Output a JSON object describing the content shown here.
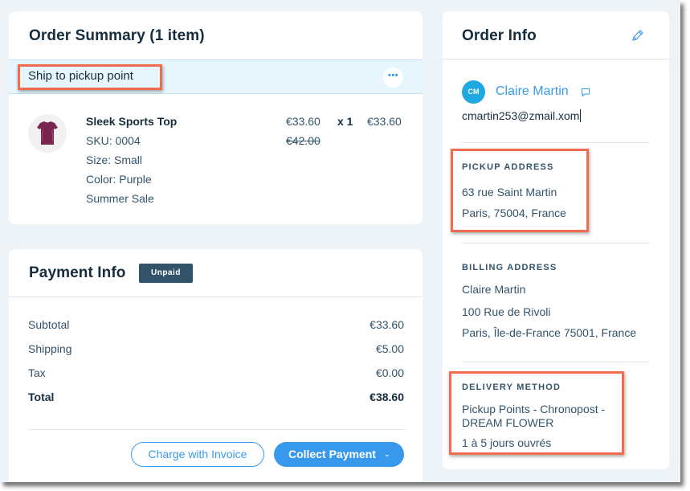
{
  "order_summary": {
    "title": "Order Summary (1 item)",
    "shipping_label": "Ship to pickup point",
    "more_icon": "more-dots-icon",
    "more_label": "•••",
    "item": {
      "name": "Sleek Sports Top",
      "sku": "SKU: 0004",
      "size": "Size: Small",
      "color": "Color: Purple",
      "promotion": "Summer Sale",
      "price": "€33.60",
      "original_price": "€42.00",
      "quantity": "x 1",
      "total": "€33.60",
      "image_icon": "purple-tshirt-thumbnail"
    }
  },
  "payment_info": {
    "title": "Payment Info",
    "status_badge": "Unpaid",
    "rows": [
      {
        "label": "Subtotal",
        "value": "€33.60"
      },
      {
        "label": "Shipping",
        "value": "€5.00"
      },
      {
        "label": "Tax",
        "value": "€0.00"
      },
      {
        "label": "Total",
        "value": "€38.60"
      }
    ],
    "charge_invoice_label": "Charge with Invoice",
    "collect_payment_label": "Collect Payment",
    "collect_payment_chevron": "⌄"
  },
  "order_info": {
    "title": "Order Info",
    "edit_icon": "pencil-icon",
    "customer": {
      "initials": "CM",
      "name": "Claire Martin",
      "email": "cmartin253@zmail.xom"
    },
    "pickup_address": {
      "title": "PICKUP ADDRESS",
      "lines": [
        "63 rue Saint Martin",
        "Paris, 75004, France"
      ]
    },
    "billing_address": {
      "title": "BILLING ADDRESS",
      "lines": [
        "Claire Martin",
        "100 Rue de Rivoli",
        "Paris, Île-de-France 75001, France"
      ]
    },
    "delivery_method": {
      "title": "DELIVERY METHOD",
      "lines": [
        "Pickup Points - Chronopost - DREAM FLOWER",
        "1 à 5 jours ouvrés"
      ]
    }
  },
  "colors": {
    "accent": "#3899ec",
    "highlight": "#f26d50",
    "badge": "#32536a",
    "avatar": "#20a8e0",
    "background": "#eef3f7"
  }
}
